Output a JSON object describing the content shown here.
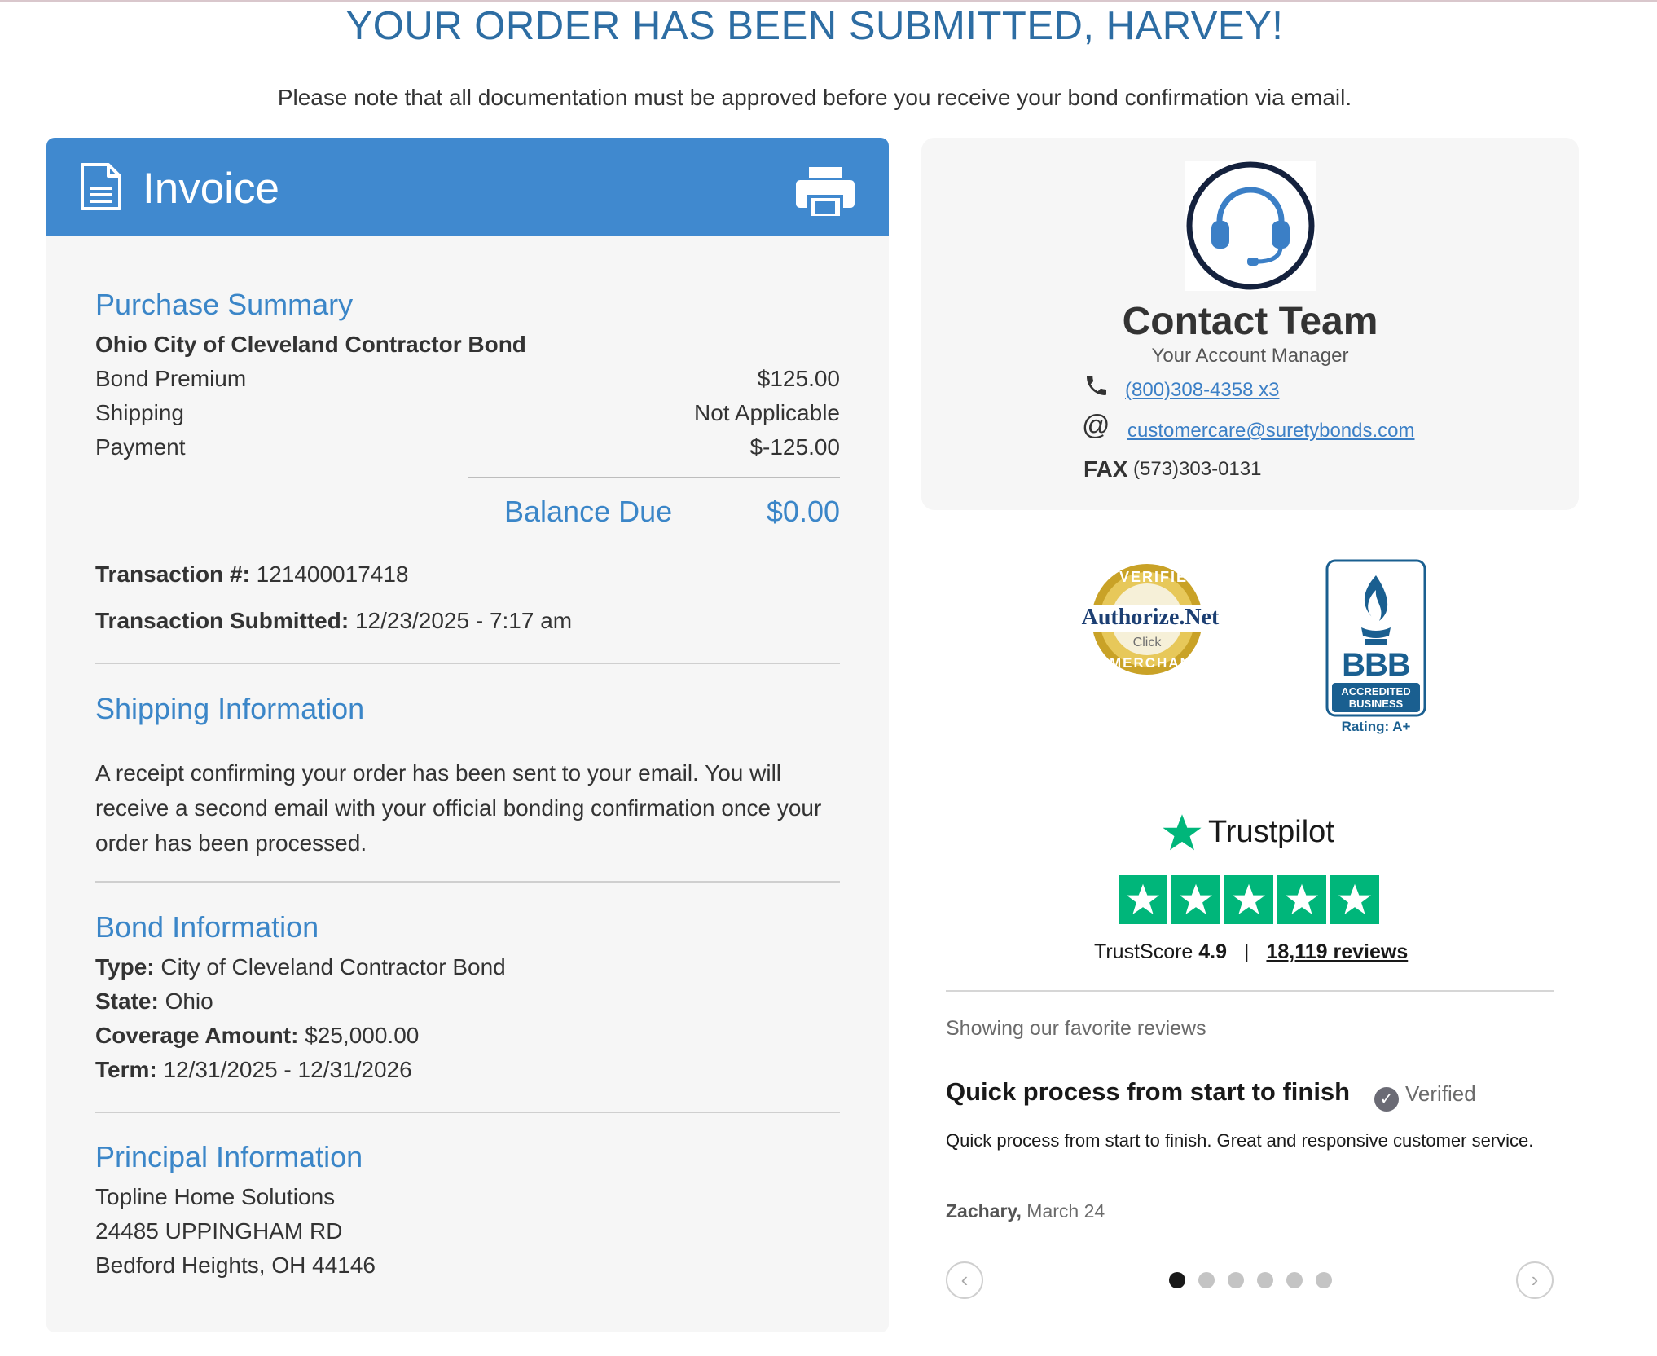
{
  "page": {
    "headline": "YOUR ORDER HAS BEEN SUBMITTED, HARVEY!",
    "subline": "Please note that all documentation must be approved before you receive your bond confirmation via email."
  },
  "invoice": {
    "title": "Invoice",
    "purchase_summary": {
      "heading": "Purchase Summary",
      "product": "Ohio City of Cleveland Contractor Bond",
      "rows": [
        {
          "label": "Bond Premium",
          "value": "$125.00"
        },
        {
          "label": "Shipping",
          "value": "Not Applicable"
        },
        {
          "label": "Payment",
          "value": "$-125.00"
        }
      ],
      "balance_label": "Balance Due",
      "balance_value": "$0.00"
    },
    "transaction": {
      "number_label": "Transaction #:",
      "number_value": "121400017418",
      "submitted_label": "Transaction Submitted:",
      "submitted_value": "12/23/2025 - 7:17 am"
    },
    "shipping": {
      "heading": "Shipping Information",
      "text": "A receipt confirming your order has been sent to your email. You will receive a second email with your official bonding confirmation once your order has been processed."
    },
    "bond": {
      "heading": "Bond Information",
      "type_label": "Type:",
      "type_value": "City of Cleveland Contractor Bond",
      "state_label": "State:",
      "state_value": "Ohio",
      "coverage_label": "Coverage Amount:",
      "coverage_value": "$25,000.00",
      "term_label": "Term:",
      "term_value": "12/31/2025 - 12/31/2026"
    },
    "principal": {
      "heading": "Principal Information",
      "name": "Topline Home Solutions",
      "street": "24485 UPPINGHAM RD",
      "city": "Bedford Heights, OH 44146"
    }
  },
  "contact": {
    "title": "Contact Team",
    "subtitle": "Your Account Manager",
    "phone": "(800)308-4358 x3",
    "email": "customercare@suretybonds.com",
    "fax_label": "FAX",
    "fax": "(573)303-0131",
    "phone_icon": "phone-icon",
    "email_icon": "at-sign-icon"
  },
  "badges": {
    "authnet_verified": "VERIFIED",
    "authnet_name": "Authorize.Net",
    "authnet_click": "Click",
    "authnet_merchant": "MERCHANT",
    "bbb_name": "BBB",
    "bbb_accredited": "ACCREDITED",
    "bbb_business": "BUSINESS",
    "bbb_rating": "Rating: A+"
  },
  "trustpilot": {
    "brand": "Trustpilot",
    "score_label": "TrustScore",
    "score": "4.9",
    "separator": "|",
    "reviews": "18,119 reviews",
    "stars": 5,
    "showing": "Showing our favorite reviews",
    "review_title": "Quick process from start to finish",
    "verified": "Verified",
    "review_body": "Quick process from start to finish. Great and responsive customer service.",
    "author": "Zachary,",
    "date": "March 24",
    "carousel_prev": "‹",
    "carousel_next": "›",
    "carousel_pages": 6,
    "carousel_active": 1,
    "star_color": "#00b67a"
  },
  "colors": {
    "accent": "#4089cf",
    "heading": "#3b86c8",
    "headline": "#2d6da3"
  }
}
